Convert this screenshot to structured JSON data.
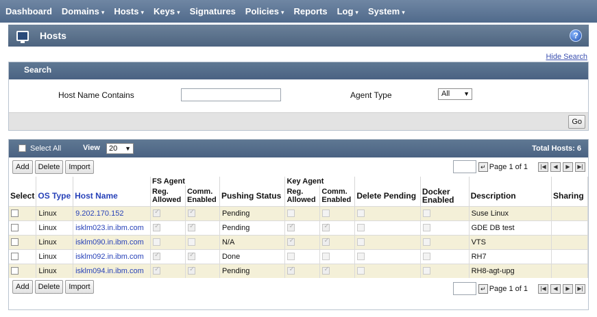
{
  "nav": {
    "items": [
      {
        "label": "Dashboard",
        "caret": false
      },
      {
        "label": "Domains",
        "caret": true
      },
      {
        "label": "Hosts",
        "caret": true
      },
      {
        "label": "Keys",
        "caret": true
      },
      {
        "label": "Signatures",
        "caret": false
      },
      {
        "label": "Policies",
        "caret": true
      },
      {
        "label": "Reports",
        "caret": false
      },
      {
        "label": "Log",
        "caret": true
      },
      {
        "label": "System",
        "caret": true
      }
    ]
  },
  "header": {
    "title": "Hosts",
    "help_glyph": "?"
  },
  "hide_search": "Hide Search",
  "search": {
    "title": "Search",
    "host_name_label": "Host Name Contains",
    "host_name_value": "",
    "agent_type_label": "Agent Type",
    "agent_type_value": "All",
    "go_label": "Go"
  },
  "hosts_bar": {
    "select_all": "Select All",
    "view_label": "View",
    "view_value": "20",
    "total_hosts": "Total Hosts: 6"
  },
  "actions": {
    "add": "Add",
    "delete": "Delete",
    "import": "Import"
  },
  "pager": {
    "page_text": "Page 1 of 1",
    "page_value": ""
  },
  "table": {
    "group_fs": "FS Agent",
    "group_key": "Key Agent",
    "headers": {
      "select": "Select",
      "os_type": "OS Type",
      "host_name": "Host Name",
      "fs_reg": "Reg. Allowed",
      "fs_comm": "Comm. Enabled",
      "pushing": "Pushing Status",
      "key_reg": "Reg. Allowed",
      "key_comm": "Comm. Enabled",
      "delete_pending": "Delete Pending",
      "docker": "Docker Enabled",
      "description": "Description",
      "sharing": "Sharing"
    },
    "rows": [
      {
        "os": "Linux",
        "host": "9.202.170.152",
        "fs_reg": true,
        "fs_comm": true,
        "pushing": "Pending",
        "key_reg": false,
        "key_comm": false,
        "description": "Suse Linux",
        "sharing": ""
      },
      {
        "os": "Linux",
        "host": "isklm023.in.ibm.com",
        "fs_reg": true,
        "fs_comm": true,
        "pushing": "Pending",
        "key_reg": true,
        "key_comm": true,
        "description": "GDE DB test",
        "sharing": ""
      },
      {
        "os": "Linux",
        "host": "isklm090.in.ibm.com",
        "fs_reg": false,
        "fs_comm": false,
        "pushing": "N/A",
        "key_reg": true,
        "key_comm": true,
        "description": "VTS",
        "sharing": ""
      },
      {
        "os": "Linux",
        "host": "isklm092.in.ibm.com",
        "fs_reg": true,
        "fs_comm": true,
        "pushing": "Done",
        "key_reg": false,
        "key_comm": false,
        "description": "RH7",
        "sharing": ""
      },
      {
        "os": "Linux",
        "host": "isklm094.in.ibm.com",
        "fs_reg": true,
        "fs_comm": true,
        "pushing": "Pending",
        "key_reg": true,
        "key_comm": true,
        "description": "RH8-agt-upg",
        "sharing": ""
      }
    ]
  },
  "colors": {
    "nav_bg": "#5d7595",
    "panel_header": "#4f6786",
    "row_highlight": "#f4f0d8",
    "link": "#2741b8"
  }
}
